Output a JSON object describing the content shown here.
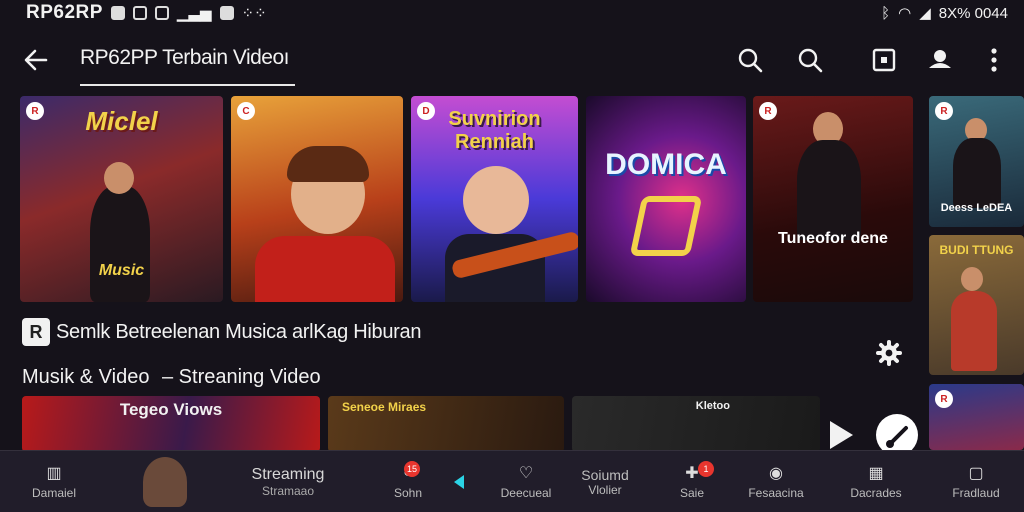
{
  "status_bar": {
    "time": "RP62RP",
    "right_text": "8X% 0044"
  },
  "app_bar": {
    "title": "RP62PP Terbain Videoı"
  },
  "thumbnails_top": [
    {
      "title": "Miclel",
      "subtitle": "Music"
    },
    {
      "title": "",
      "subtitle": ""
    },
    {
      "title": "Suvnirion Renniah",
      "subtitle": ""
    },
    {
      "title": "DOMICA",
      "subtitle": ""
    },
    {
      "title": "Tuneofor dene",
      "subtitle": ""
    },
    {
      "title": "Deess LeDEA",
      "subtitle": ""
    }
  ],
  "thumb_side_2": {
    "title": "BUDI TTUNG"
  },
  "section": {
    "icon": "R",
    "title": "Semlk Betreelenan Musica arlKag Hiburan"
  },
  "sub_section": {
    "title": "Musik & Video",
    "subtitle": "– Streaning Video"
  },
  "thumbnails_bottom": [
    {
      "title": "Tegeo Viows"
    },
    {
      "title": "Seneoe Miraes"
    },
    {
      "title": "Kletoo"
    }
  ],
  "bottom_nav": [
    {
      "label": "Damaiel",
      "icon": "grid-icon"
    },
    {
      "label": "",
      "icon": "avatar-icon"
    },
    {
      "label": "Streaming",
      "sublabel": "Stramaao",
      "icon": ""
    },
    {
      "label": "Sohn",
      "badge": "15",
      "icon": "person-icon"
    },
    {
      "label": "Deecueal",
      "icon": "heart-icon"
    },
    {
      "label": "Soiumd",
      "sublabel": "Vlolier",
      "icon": ""
    },
    {
      "label": "Saie",
      "badge": "1",
      "icon": "chat-icon"
    },
    {
      "label": "Fesaacina",
      "icon": "record-icon"
    },
    {
      "label": "Dacrades",
      "icon": "grid-icon"
    },
    {
      "label": "Fradlaud",
      "icon": "square-icon"
    }
  ],
  "colors": {
    "background": "#15121a",
    "nav": "#211d2a",
    "accent_red": "#e8352e",
    "accent_cyan": "#2bd4e6"
  }
}
